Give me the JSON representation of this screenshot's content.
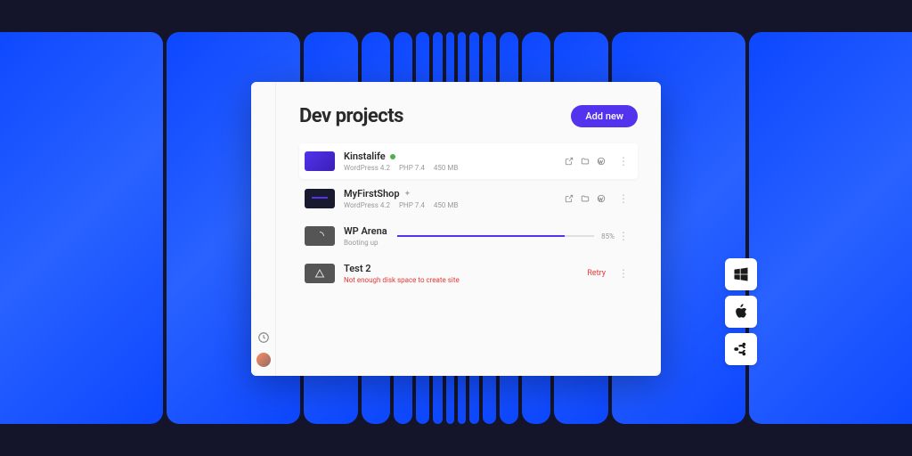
{
  "header": {
    "title": "Dev projects",
    "add_button_label": "Add new"
  },
  "projects": [
    {
      "name": "Kinstalife",
      "wp": "WordPress 4.2",
      "php": "PHP 7.4",
      "size": "450 MB",
      "status": "running"
    },
    {
      "name": "MyFirstShop",
      "wp": "WordPress 4.2",
      "php": "PHP 7.4",
      "size": "450 MB",
      "status": "idle"
    },
    {
      "name": "WP Arena",
      "status_text": "Booting up",
      "progress_pct": "85%",
      "progress": 85
    },
    {
      "name": "Test 2",
      "error": "Not enough disk space to create site",
      "retry_label": "Retry"
    }
  ],
  "os_badges": [
    "windows",
    "apple",
    "ubuntu"
  ],
  "colors": {
    "accent": "#5333ed",
    "error": "#e53935",
    "success": "#4caf50"
  }
}
